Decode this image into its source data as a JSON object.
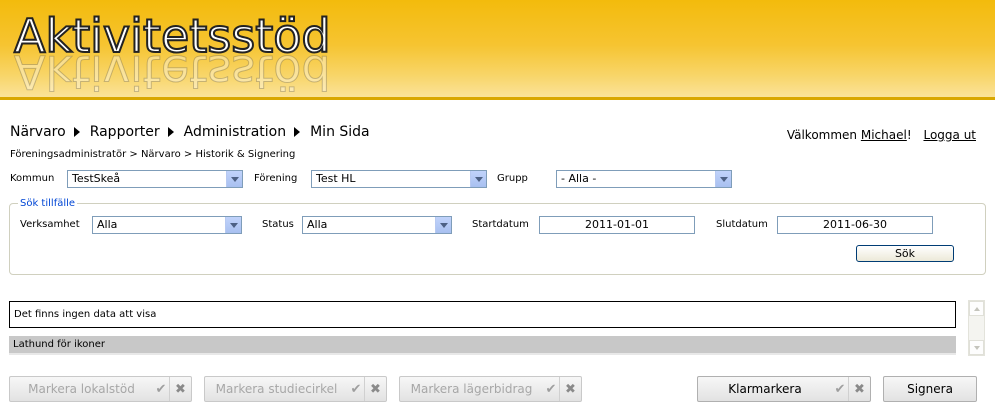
{
  "header": {
    "logo_text": "Aktivitetsstöd"
  },
  "nav": {
    "items": [
      "Närvaro",
      "Rapporter",
      "Administration",
      "Min Sida"
    ]
  },
  "user": {
    "welcome_prefix": "Välkommen ",
    "name": "Michael",
    "exclaim": "!",
    "logout": "Logga ut"
  },
  "breadcrumb": "Föreningsadministratör > Närvaro > Historik & Signering",
  "filters": {
    "kommun_label": "Kommun",
    "kommun_value": "TestSkeå",
    "forening_label": "Förening",
    "forening_value": "Test HL",
    "grupp_label": "Grupp",
    "grupp_value": "- Alla -"
  },
  "search": {
    "legend": "Sök tillfälle",
    "verksamhet_label": "Verksamhet",
    "verksamhet_value": "Alla",
    "status_label": "Status",
    "status_value": "Alla",
    "startdatum_label": "Startdatum",
    "startdatum_value": "2011-01-01",
    "slutdatum_label": "Slutdatum",
    "slutdatum_value": "2011-06-30",
    "search_button": "Sök"
  },
  "results": {
    "empty_message": "Det finns ingen data att visa",
    "lathund_label": "Lathund för ikoner"
  },
  "actions": {
    "lokalstod": "Markera lokalstöd",
    "studiecirkel": "Markera studiecirkel",
    "lagerbidrag": "Markera lägerbidrag",
    "klarmarkera": "Klarmarkera",
    "signera": "Signera",
    "check_glyph": "✔",
    "x_glyph": "✖"
  }
}
